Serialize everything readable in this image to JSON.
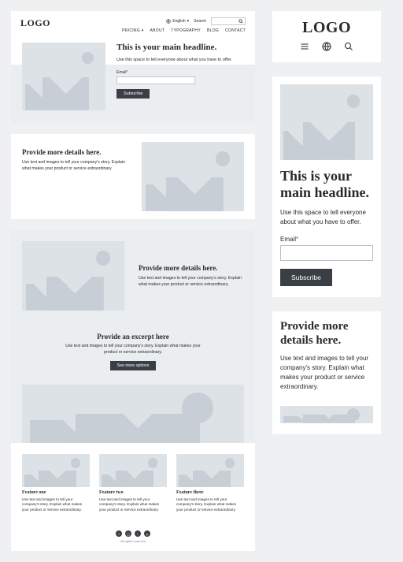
{
  "brand": {
    "logo": "LOGO"
  },
  "topbar": {
    "language": "English",
    "search_label": "Search",
    "search_placeholder": ""
  },
  "nav": {
    "pricing": "PRICING",
    "about": "ABOUT",
    "typography": "TYPOGRAPHY",
    "blog": "BLOG",
    "contact": "CONTACT"
  },
  "hero": {
    "headline": "This is your main headline.",
    "sub": "Use this space to tell everyone about what you have to offer.",
    "email_label": "Email",
    "required": "*",
    "subscribe": "Subscribe"
  },
  "details": {
    "heading": "Provide more details here.",
    "body": "Use text and images to tell your company's story. Explain what makes your product or service extraordinary."
  },
  "excerpt": {
    "heading": "Provide an excerpt here",
    "body": "Use text and images to tell your company's story. Explain what makes your product or service extraordinary.",
    "cta": "See more options"
  },
  "features": [
    {
      "title": "Feature one",
      "body": "Use text and images to tell your company's story. Explain what makes your product or service extraordinary."
    },
    {
      "title": "Feature two",
      "body": "Use text and images to tell your company's story. Explain what makes your product or service extraordinary."
    },
    {
      "title": "Feature three",
      "body": "Use text and images to tell your company's story. Explain what makes your product or service extraordinary."
    }
  ],
  "footer": {
    "copyright": "All rights reserved"
  },
  "mobile": {
    "headline": "This is your main headline.",
    "sub": "Use this space to tell everyone about what you have to offer.",
    "email_label": "Email",
    "required": "*",
    "subscribe": "Subscribe",
    "details_heading": "Provide more details here.",
    "details_body": "Use text and images to tell your company's story. Explain what makes your product or service extraordinary."
  }
}
